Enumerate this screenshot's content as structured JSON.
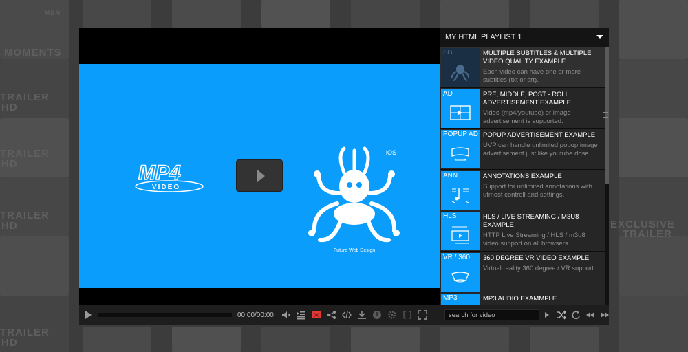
{
  "background": {
    "labels": [
      "MEN",
      "MOMENTS",
      "TRAILER",
      "HD",
      "TRAILER",
      "HD",
      "TRAILER",
      "HD",
      "TRAILER",
      "HD",
      "EXCLUSIVE",
      "TRAILER"
    ]
  },
  "video": {
    "mp4_logo_text": "MP4",
    "mp4_logo_sub": "VIDEO",
    "brand_caption": "Future Web Design",
    "brand_os_label": "iOS",
    "time_display": "00:00/00:00",
    "colors": {
      "frame": "#0a9dfb",
      "bar": "#1e1e1e"
    }
  },
  "controls": {
    "icons": [
      "play-icon",
      "volume-icon",
      "playlist-toggle-icon",
      "subtitles-icon",
      "share-icon",
      "embed-icon",
      "download-icon",
      "info-icon",
      "settings-icon",
      "theater-icon",
      "fullscreen-icon"
    ]
  },
  "playlist": {
    "title": "MY HTML PLAYLIST 1",
    "items": [
      {
        "tag": "SB",
        "title": "MULTIPLE SUBTITLES & MULTIPLE VIDEO QUALITY EXAMPLE",
        "desc": "Each video can have one or more subtitles (txt or srt).",
        "active": true
      },
      {
        "tag": "AD",
        "title": "PRE, MIDDLE, POST - ROLL ADVERTISEMENT EXAMPLE",
        "desc": "Video (mp4/youtube) or image advertisement is supported.",
        "active": false
      },
      {
        "tag": "POPUP AD",
        "title": "POPUP ADVERTISEMENT EXAMPLE",
        "desc": "UVP can handle unlimited popup image advertisement just like youtube dose.",
        "active": false
      },
      {
        "tag": "ANN",
        "title": "ANNOTATIONS EXAMPLE",
        "desc": "Support for unlimited annotations with utmost controll and settings.",
        "active": false
      },
      {
        "tag": "HLS",
        "title": "HLS / LIVE STREAMING / m3u8 EXAMPLE",
        "desc": "HTTP Live Streaming / HLS / m3u8 video support on all browsers.",
        "active": false
      },
      {
        "tag": "VR / 360",
        "title": "360 DEGREE VR VIDEO EXAMPLE",
        "desc": "Virtual reality 360 degree / VR support.",
        "active": false
      },
      {
        "tag": "MP3",
        "title": "MP3 AUDIO EXAMMPLE",
        "desc": "",
        "active": false
      }
    ],
    "search_placeholder": "search for video",
    "footer_icons": [
      "play-next-icon",
      "shuffle-icon",
      "loop-icon",
      "previous-icon",
      "next-icon"
    ]
  }
}
